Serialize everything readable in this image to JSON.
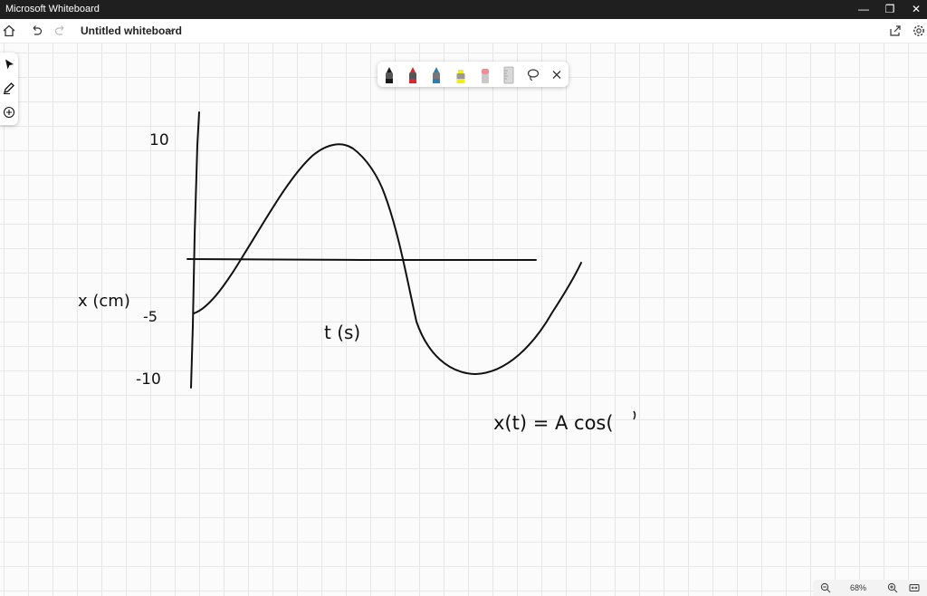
{
  "window": {
    "title": "Microsoft Whiteboard",
    "minimize_glyph": "—",
    "restore_glyph": "❐",
    "close_glyph": "✕"
  },
  "appbar": {
    "document_title": "Untitled whiteboard",
    "icons": [
      "home-icon",
      "undo-icon",
      "redo-icon",
      "chevron-down-icon",
      "share-icon",
      "settings-icon"
    ]
  },
  "left_toolbar": {
    "tools": [
      "select-icon",
      "pen-icon",
      "add-icon"
    ]
  },
  "pen_tray": {
    "pens": [
      {
        "name": "black-pen",
        "color": "#1a1a1a"
      },
      {
        "name": "red-pen",
        "color": "#e0252f"
      },
      {
        "name": "blue-pen",
        "color": "#2a7db5"
      },
      {
        "name": "highlighter",
        "color": "#f4ec1c"
      },
      {
        "name": "eraser",
        "color": "#ef8d95"
      },
      {
        "name": "ruler",
        "color": "#b5b5b5"
      }
    ],
    "extra_icons": [
      "lasso-icon",
      "close-icon"
    ]
  },
  "whiteboard": {
    "ink_color": "#111111",
    "labels": {
      "y_tick_top": "10",
      "y_tick_mid": "-5",
      "y_tick_bottom": "-10",
      "y_axis_label": "x (cm)",
      "x_axis_label": "t (s)",
      "equation": "x(t) = A cos("
    }
  },
  "zoom": {
    "level": "68%",
    "icons": [
      "zoom-out-icon",
      "zoom-in-icon",
      "fit-to-screen-icon"
    ]
  },
  "colors": {
    "titlebar_bg": "#1f1f1f",
    "canvas_bg": "#fbfbfb",
    "grid_line": "#e7e7e7"
  }
}
